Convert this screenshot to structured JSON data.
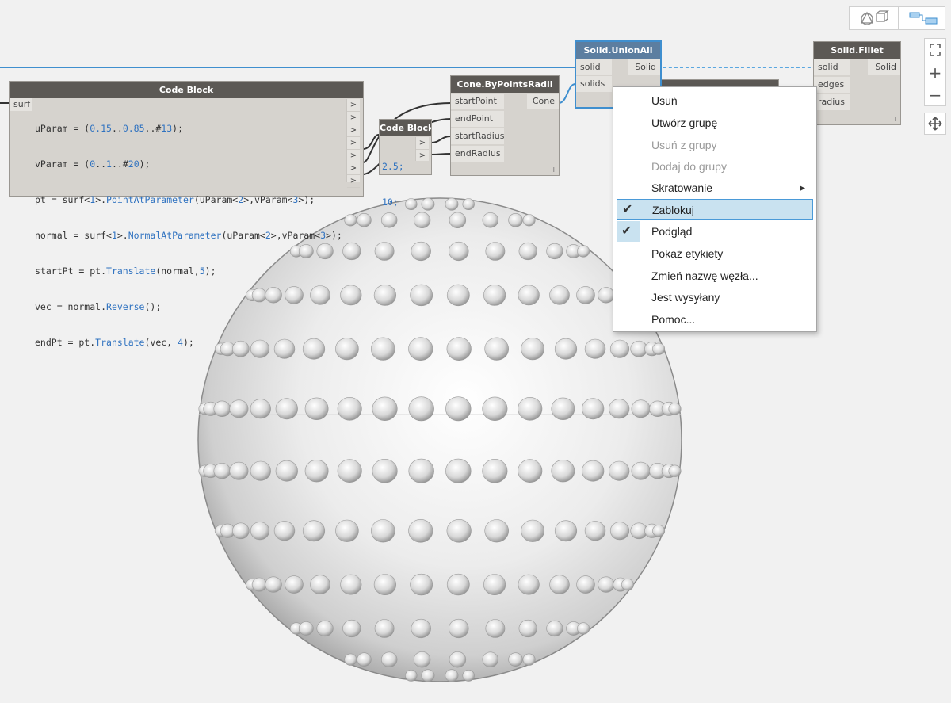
{
  "code_block_main": {
    "title": "Code Block",
    "input_label": "surf",
    "lines": [
      "uParam = (0.15..0.85..#13);",
      "vParam = (0..1..#20);",
      "pt = surf<1>.PointAtParameter(uParam<2>,vParam<3>);",
      "normal = surf<1>.NormalAtParameter(uParam<2>,vParam<3>);",
      "startPt = pt.Translate(normal,5);",
      "vec = normal.Reverse();",
      "endPt = pt.Translate(vec, 4);"
    ],
    "arrow": ">"
  },
  "code_block_small": {
    "title": "Code Block",
    "lines": [
      "2.5;",
      "10;"
    ],
    "arrow": ">"
  },
  "cone_node": {
    "title": "Cone.ByPointsRadii",
    "inputs": [
      "startPoint",
      "endPoint",
      "startRadius",
      "endRadius"
    ],
    "output": "Cone",
    "lacing": "I"
  },
  "union_node": {
    "title": "Solid.UnionAll",
    "inputs": [
      "solid",
      "solids"
    ],
    "output": "Solid"
  },
  "fillet_node": {
    "title": "Solid.Fillet",
    "inputs": [
      "solid",
      "edges",
      "radius"
    ],
    "output": "Solid",
    "lacing": "I"
  },
  "context_menu": {
    "items": [
      {
        "label": "Usuń",
        "enabled": true,
        "checked": false
      },
      {
        "label": "Utwórz grupę",
        "enabled": true,
        "checked": false
      },
      {
        "label": "Usuń z grupy",
        "enabled": false,
        "checked": false
      },
      {
        "label": "Dodaj do grupy",
        "enabled": false,
        "checked": false
      },
      {
        "label": "Skratowanie",
        "enabled": true,
        "checked": false,
        "submenu": true
      },
      {
        "label": "Zablokuj",
        "enabled": true,
        "checked": true,
        "highlighted": true
      },
      {
        "label": "Podgląd",
        "enabled": true,
        "checked": true
      },
      {
        "label": "Pokaż etykiety",
        "enabled": true,
        "checked": false
      },
      {
        "label": "Zmień nazwę węzła...",
        "enabled": true,
        "checked": false
      },
      {
        "label": "Jest wysyłany",
        "enabled": true,
        "checked": false
      },
      {
        "label": "Pomoc...",
        "enabled": true,
        "checked": false
      }
    ]
  },
  "colors": {
    "accent": "#3f8fcf",
    "node_header": "#5c5955",
    "node_body": "#d6d3ce",
    "menu_highlight": "#c9e2f0"
  },
  "icons": {
    "view_3d": "3d-preview-icon",
    "view_graph": "graph-view-icon",
    "zoom_fit": "zoom-fit-icon",
    "zoom_in": "zoom-in-icon",
    "zoom_out": "zoom-out-icon",
    "pan": "pan-icon",
    "check": "checkmark-icon",
    "submenu": "submenu-arrow-icon"
  },
  "symbols": {
    "zoom_in": "+",
    "zoom_out": "−"
  }
}
